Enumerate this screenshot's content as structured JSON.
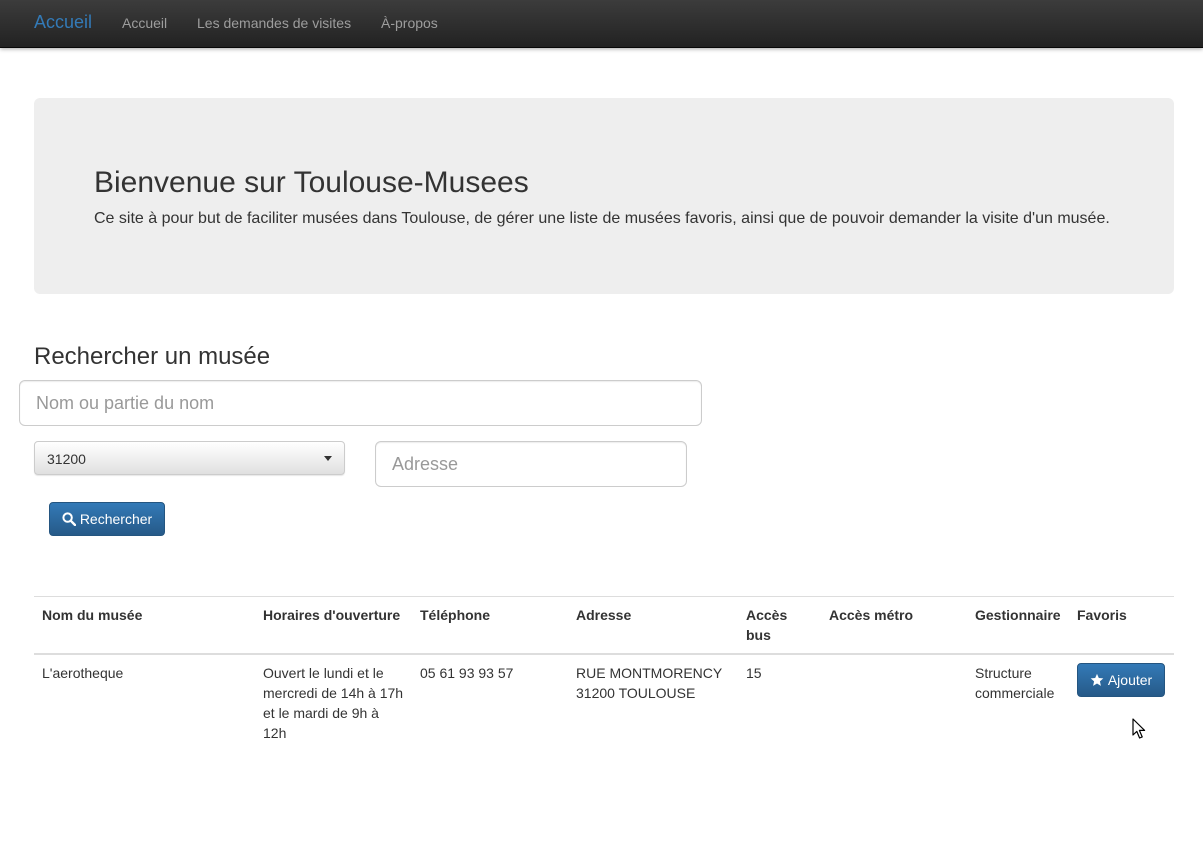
{
  "navbar": {
    "brand": "Accueil",
    "links": [
      "Accueil",
      "Les demandes de visites",
      "À-propos"
    ]
  },
  "jumbotron": {
    "title": "Bienvenue sur Toulouse-Musees",
    "text": "Ce site à pour but de faciliter musées dans Toulouse, de gérer une liste de musées favoris, ainsi que de pouvoir demander la visite d'un musée."
  },
  "search": {
    "title": "Rechercher un musée",
    "name_placeholder": "Nom ou partie du nom",
    "name_value": "",
    "postal_selected": "31200",
    "address_placeholder": "Adresse",
    "address_value": "",
    "button_label": "Rechercher",
    "button_icon": "search-icon"
  },
  "table": {
    "headers": [
      "Nom du musée",
      "Horaires d'ouverture",
      "Téléphone",
      "Adresse",
      "Accès bus",
      "Accès métro",
      "Gestionnaire",
      "Favoris"
    ],
    "rows": [
      {
        "nom": "L'aerotheque",
        "horaires": "Ouvert le lundi et le mercredi de 14h à 17h et le mardi de 9h à 12h",
        "telephone": "05 61 93 93 57",
        "adresse": "RUE MONTMORENCY 31200 TOULOUSE",
        "bus": "15",
        "metro": "",
        "gestionnaire": "Structure commerciale",
        "favoris_label": "Ajouter",
        "favoris_icon": "star-icon"
      }
    ]
  },
  "colors": {
    "navbar_bg": "#222222",
    "brand": "#337ab7",
    "nav_link": "#9d9d9d",
    "jumbotron_bg": "#eeeeee",
    "primary": "#337ab7"
  }
}
